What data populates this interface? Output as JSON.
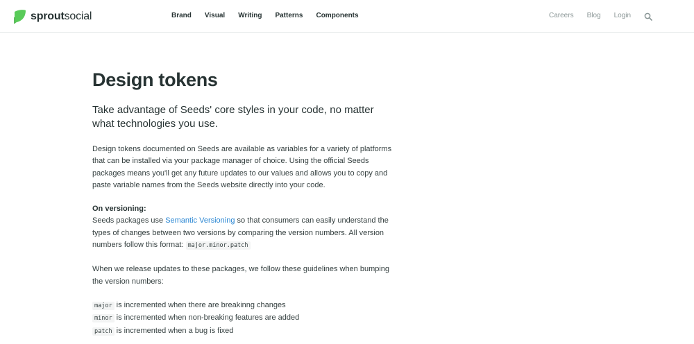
{
  "header": {
    "logo": {
      "bold": "sprout",
      "regular": "social",
      "brand_color": "#59cb59"
    },
    "nav_main": [
      "Brand",
      "Visual",
      "Writing",
      "Patterns",
      "Components"
    ],
    "nav_right": [
      "Careers",
      "Blog",
      "Login"
    ],
    "search_icon": "search-icon"
  },
  "main": {
    "title": "Design tokens",
    "lead": "Take advantage of Seeds' core styles in your code, no matter what technologies you use.",
    "intro": "Design tokens documented on Seeds are available as variables for a variety of platforms that can be installed via your package manager of choice. Using the official Seeds packages means you'll get any future updates to our values and allows you to copy and paste variable names from the Seeds website directly into your code.",
    "versioning": {
      "heading": "On versioning:",
      "text_before": "Seeds packages use ",
      "link": "Semantic Versioning",
      "text_after": " so that consumers can easily understand the types of changes between two versions by comparing the version numbers. All version numbers follow this format: ",
      "format_code": "major.minor.patch"
    },
    "release_text": "When we release updates to these packages, we follow these guidelines when bumping the version numbers:",
    "guidelines": [
      {
        "code": "major",
        "text": " is incremented when there are breakinng changes"
      },
      {
        "code": "minor",
        "text": " is incremented when non-breaking features are added"
      },
      {
        "code": "patch",
        "text": " is incremented when a bug is fixed"
      }
    ],
    "link_color": "#2b87d3"
  }
}
